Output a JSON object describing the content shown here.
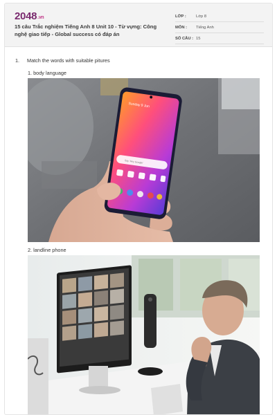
{
  "header": {
    "logo_main": "2048",
    "logo_suffix": ".vn",
    "title": "15 câu Trắc nghiệm Tiếng Anh 8 Unit 10 - Từ vựng: Công nghệ giao tiếp - Global success có đáp án"
  },
  "meta": [
    {
      "key": "LỚP :",
      "value": "Lớp 8"
    },
    {
      "key": "MÔN :",
      "value": "Tiếng Anh"
    },
    {
      "key": "SỐ CÂU :",
      "value": "15"
    }
  ],
  "question": {
    "number": "1.",
    "text": "Match the words with suitable pitures"
  },
  "items": [
    {
      "label": "1. body language",
      "image_icon": "smartphone-in-hand-photo"
    },
    {
      "label": "2. landline phone",
      "image_icon": "video-conference-photo"
    }
  ],
  "phone_screen": {
    "time": "Sunday 9 Jun",
    "search_placeholder": "Say 'Hey Google'"
  },
  "colors": {
    "logo": "#7a2a6e",
    "header_bg": "#f3f3f3"
  }
}
